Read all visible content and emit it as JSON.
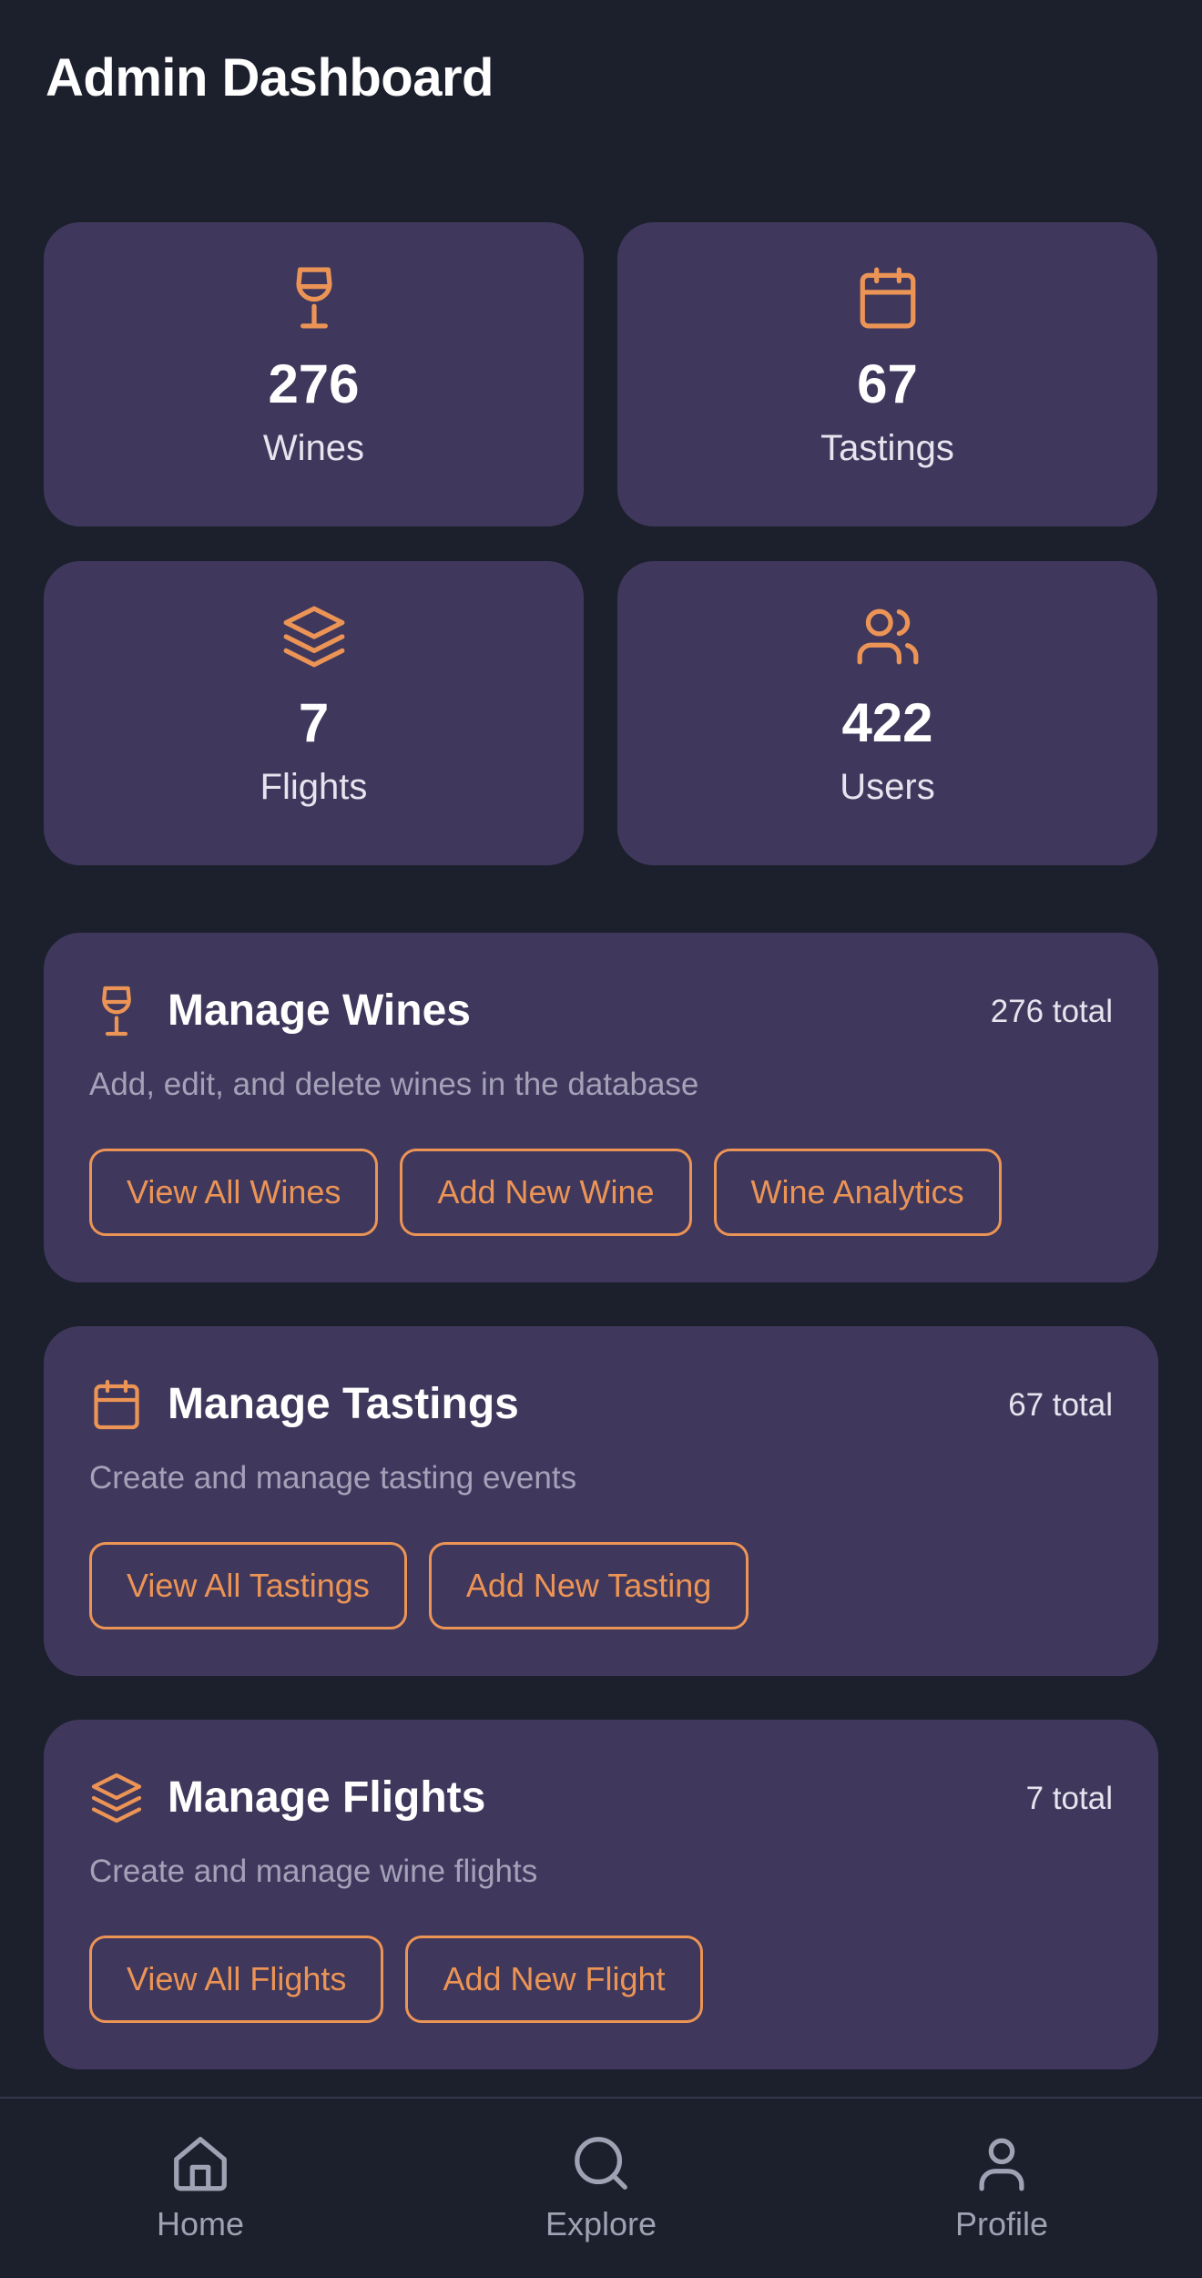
{
  "header": {
    "title": "Admin Dashboard"
  },
  "theme": {
    "background": "#1c1f2c",
    "card": "#3f385c",
    "accent": "#ec9455",
    "muted_text": "#a5a1b8",
    "nav_icon": "#9ea3b3"
  },
  "stats": [
    {
      "icon": "wine-glass-icon",
      "value": "276",
      "label": "Wines"
    },
    {
      "icon": "calendar-icon",
      "value": "67",
      "label": "Tastings"
    },
    {
      "icon": "layers-icon",
      "value": "7",
      "label": "Flights"
    },
    {
      "icon": "users-icon",
      "value": "422",
      "label": "Users"
    }
  ],
  "sections": [
    {
      "icon": "wine-glass-icon",
      "title": "Manage Wines",
      "count": "276 total",
      "description": "Add, edit, and delete wines in the database",
      "buttons": [
        "View All Wines",
        "Add New Wine",
        "Wine Analytics"
      ]
    },
    {
      "icon": "calendar-icon",
      "title": "Manage Tastings",
      "count": "67 total",
      "description": "Create and manage tasting events",
      "buttons": [
        "View All Tastings",
        "Add New Tasting"
      ]
    },
    {
      "icon": "layers-icon",
      "title": "Manage Flights",
      "count": "7 total",
      "description": "Create and manage wine flights",
      "buttons": [
        "View All Flights",
        "Add New Flight"
      ]
    }
  ],
  "bottom_nav": [
    {
      "icon": "home-icon",
      "label": "Home"
    },
    {
      "icon": "search-icon",
      "label": "Explore"
    },
    {
      "icon": "user-icon",
      "label": "Profile"
    }
  ]
}
